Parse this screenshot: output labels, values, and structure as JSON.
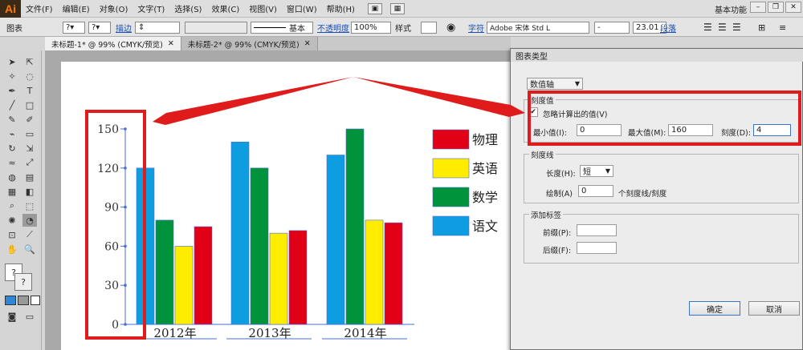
{
  "app": {
    "logo": "Ai",
    "workspace": "基本功能"
  },
  "menu": [
    "文件(F)",
    "编辑(E)",
    "对象(O)",
    "文字(T)",
    "选择(S)",
    "效果(C)",
    "视图(V)",
    "窗口(W)",
    "帮助(H)"
  ],
  "control": {
    "label": "图表",
    "stroke_label": "描边",
    "stroke_style": "基本",
    "opacity_label": "不透明度",
    "opacity_value": "100%",
    "style_label": "样式",
    "font_label": "字符",
    "font_value": "Adobe 宋体 Std L",
    "font_style": "-",
    "font_size": "23.01",
    "para_label": "段落"
  },
  "tabs": [
    "未标题-1* @ 99% (CMYK/预览)",
    "未标题-2* @ 99% (CMYK/预览)"
  ],
  "chart_data": {
    "type": "bar",
    "categories": [
      "2012年",
      "2013年",
      "2014年"
    ],
    "series": [
      {
        "name": "语文",
        "color": "#0d9de0",
        "values": [
          120,
          140,
          130
        ]
      },
      {
        "name": "数学",
        "color": "#00933b",
        "values": [
          80,
          120,
          150
        ]
      },
      {
        "name": "英语",
        "color": "#ffed00",
        "values": [
          60,
          70,
          80
        ]
      },
      {
        "name": "物理",
        "color": "#e10016",
        "values": [
          75,
          72,
          78
        ]
      }
    ],
    "legend_order": [
      "物理",
      "英语",
      "数学",
      "语文"
    ],
    "ylim": [
      0,
      150
    ],
    "yticks": [
      "0",
      "30",
      "60",
      "90",
      "120",
      "150"
    ]
  },
  "dialog": {
    "title": "图表类型",
    "axis_select": "数值轴",
    "group_tick_values": "刻度值",
    "override_label": "忽略计算出的值(V)",
    "override_checked": "✔",
    "min_label": "最小值(I):",
    "min_value": "0",
    "max_label": "最大值(M):",
    "max_value": "160",
    "div_label": "刻度(D):",
    "div_value": "4",
    "group_tick_marks": "刻度线",
    "length_label": "长度(H):",
    "length_value": "短",
    "draw_label": "绘制(A)",
    "draw_value": "0",
    "draw_suffix": "个刻度线/刻度",
    "group_labels": "添加标签",
    "prefix_label": "前缀(P):",
    "suffix_label": "后缀(F):",
    "ok": "确定",
    "cancel": "取消"
  },
  "colors": {
    "highlight": "#e01b1b",
    "logo": "#ff7c00"
  }
}
